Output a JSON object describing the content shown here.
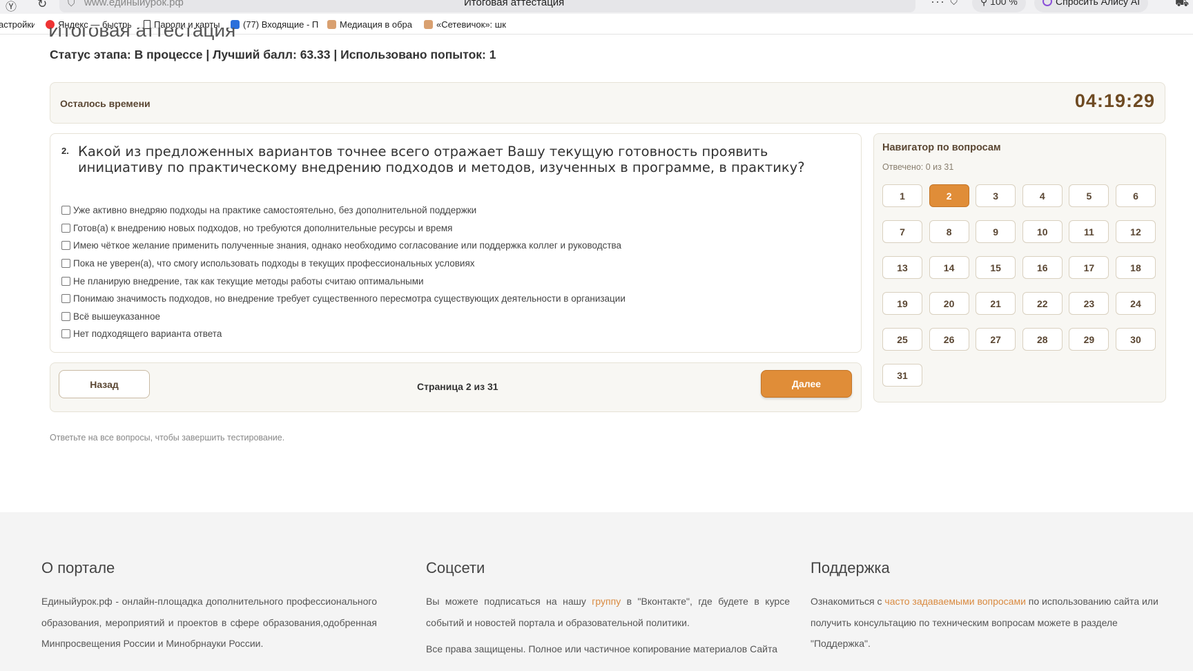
{
  "browser": {
    "url": "www.единыйурок.рф",
    "tab_title": "Итоговая аттестация",
    "zoom": "100 %",
    "alice_label": "Спросить Алису AI",
    "bookmarks": [
      {
        "label": "астройки"
      },
      {
        "label": "Яндекс — быстры"
      },
      {
        "label": "Пароли и карты"
      },
      {
        "label": "(77) Входящие - П"
      },
      {
        "label": "Медиация в обра"
      },
      {
        "label": "«Сетевичок»: шк"
      }
    ]
  },
  "page": {
    "title_clipped": "Итоговая аттестация",
    "status": "Статус этапа: В процессе | Лучший балл: 63.33 | Использовано попыток: 1"
  },
  "timer": {
    "label": "Осталось времени",
    "value": "04:19:29"
  },
  "question": {
    "number": "2.",
    "text": "Какой из предложенных вариантов точнее всего отражает Вашу текущую готовность проявить инициативу по практическому внедрению подходов и методов, изученных в программе, в практику?",
    "options": [
      "Уже активно внедряю подходы на практике самостоятельно, без дополнительной поддержки",
      "Готов(а) к внедрению новых подходов, но требуются дополнительные ресурсы и время",
      "Имею чёткое желание применить полученные знания, однако необходимо согласование или поддержка коллег и руководства",
      "Пока не уверен(а), что смогу использовать подходы в текущих профессиональных условиях",
      "Не планирую внедрение, так как текущие методы работы считаю оптимальными",
      "Понимаю значимость подходов, но внедрение требует существенного пересмотра существующих деятельности в организации",
      "Всё вышеуказанное",
      "Нет подходящего варианта ответа"
    ]
  },
  "pager": {
    "back_label": "Назад",
    "page_indicator": "Страница 2 из 31",
    "next_label": "Далее"
  },
  "hint": "Ответьте на все вопросы, чтобы завершить тестирование.",
  "navigator": {
    "title": "Навигатор по вопросам",
    "answered": "Отвечено: 0 из 31",
    "current": 2,
    "questions": [
      "1",
      "2",
      "3",
      "4",
      "5",
      "6",
      "7",
      "8",
      "9",
      "10",
      "11",
      "12",
      "13",
      "14",
      "15",
      "16",
      "17",
      "18",
      "19",
      "20",
      "21",
      "22",
      "23",
      "24",
      "25",
      "26",
      "27",
      "28",
      "29",
      "30",
      "31"
    ]
  },
  "footer": {
    "about": {
      "heading": "О портале",
      "text": "Единыйурок.рф - онлайн-площадка дополнительного профессионального образования, мероприятий и проектов в сфере образования,одобренная Минпросвещения России и Минобрнауки России."
    },
    "social": {
      "heading": "Соцсети",
      "text_before": "Вы можете подписаться на нашу ",
      "link": "группу",
      "text_after": " в \"Вконтакте\", где будете в курсе событий и новостей портала и образовательной политики.",
      "rights": "Все права защищены. Полное или частичное копирование материалов Сайта"
    },
    "support": {
      "heading": "Поддержка",
      "text_before": "Ознакомиться с ",
      "link": "часто задаваемыми вопросами",
      "text_after": " по использованию сайта или получить консультацию по техническим вопросам можете в разделе \"Поддержка\"."
    }
  },
  "colors": {
    "accent": "#e08d38",
    "brown_text": "#5a4632",
    "link": "#d98a40"
  }
}
